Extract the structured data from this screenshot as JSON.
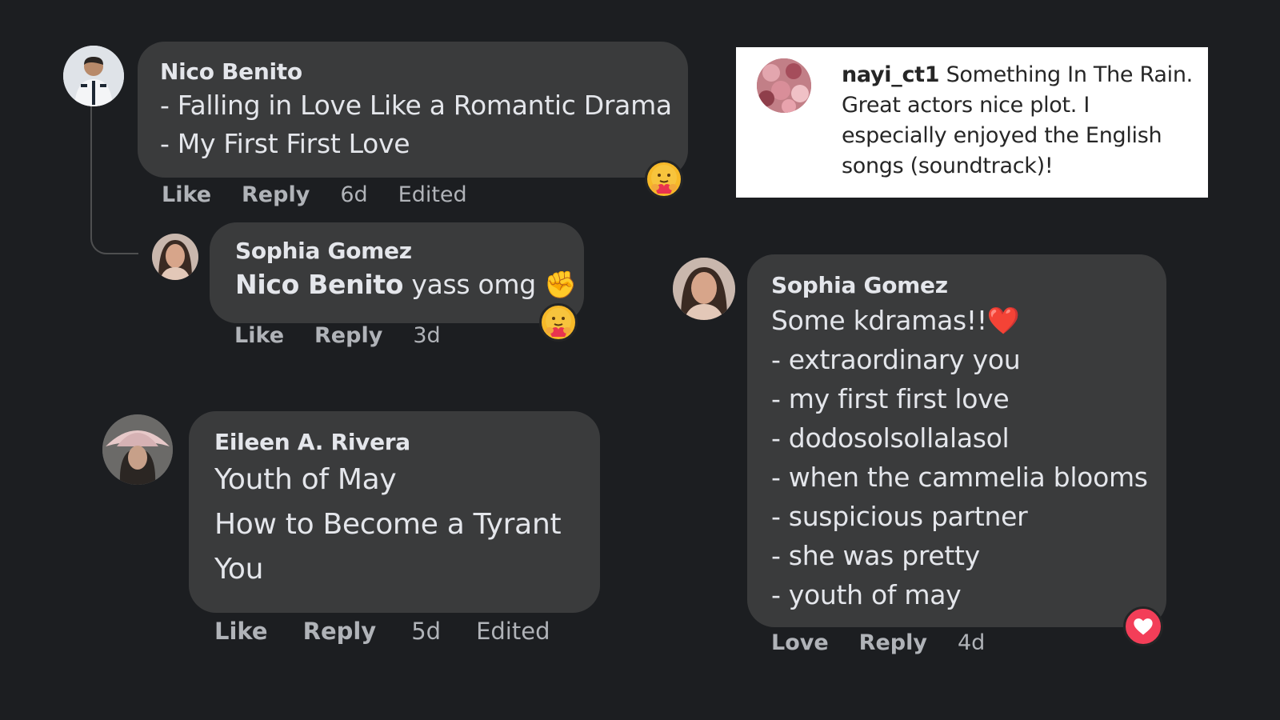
{
  "comments": {
    "nico": {
      "author": "Nico Benito",
      "lines": [
        "- Falling in Love Like a Romantic Drama",
        "- My First First Love"
      ],
      "actions": {
        "like": "Like",
        "reply": "Reply",
        "time": "6d",
        "edited": "Edited"
      },
      "reaction": "care-emoji"
    },
    "sophia_reply": {
      "author": "Sophia Gomez",
      "mention": "Nico Benito",
      "text": "yass omg ✊",
      "actions": {
        "like": "Like",
        "reply": "Reply",
        "time": "3d"
      },
      "reaction": "care-emoji"
    },
    "eileen": {
      "author": "Eileen A. Rivera",
      "lines": [
        "Youth of May",
        "How to Become a Tyrant",
        "You"
      ],
      "actions": {
        "like": "Like",
        "reply": "Reply",
        "time": "5d",
        "edited": "Edited"
      }
    },
    "sophia_main": {
      "author": "Sophia Gomez",
      "lines": [
        "Some kdramas!!❤️",
        "- extraordinary you",
        "- my first first love",
        "- dodosolsollalasol",
        "- when the cammelia blooms",
        "- suspicious partner",
        "- she was pretty",
        "- youth of may"
      ],
      "actions": {
        "love": "Love",
        "reply": "Reply",
        "time": "4d"
      },
      "reaction": "heart-icon"
    }
  },
  "instagram": {
    "username": "nayi_ct1",
    "text": "Something In The Rain. Great actors nice plot. I especially enjoyed the English songs (soundtrack)!"
  },
  "colors": {
    "background": "#1c1e21",
    "bubble": "#3a3b3c",
    "text": "#e4e6eb",
    "meta": "#b0b3b8",
    "love": "#f33e58"
  }
}
